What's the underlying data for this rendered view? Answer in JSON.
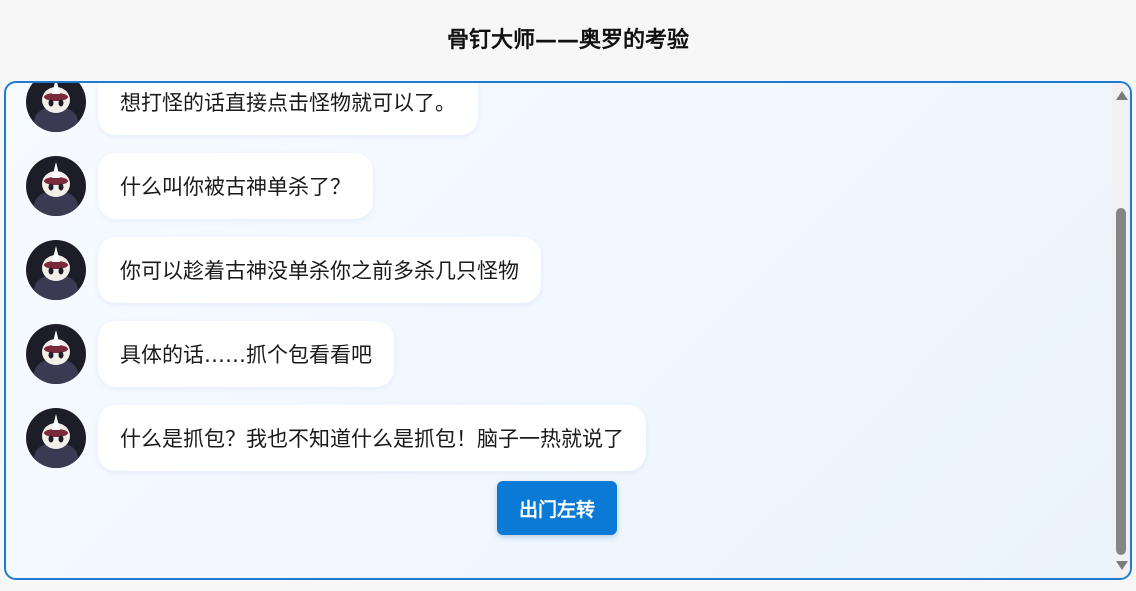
{
  "header": {
    "title": "骨钉大师——奥罗的考验"
  },
  "chat": {
    "messages": [
      {
        "text": "想打怪的话直接点击怪物就可以了。",
        "avatar": "horned-knight-avatar"
      },
      {
        "text": "什么叫你被古神单杀了？",
        "avatar": "horned-knight-avatar"
      },
      {
        "text": "你可以趁着古神没单杀你之前多杀几只怪物",
        "avatar": "horned-knight-avatar"
      },
      {
        "text": "具体的话……抓个包看看吧",
        "avatar": "horned-knight-avatar"
      },
      {
        "text": "什么是抓包？我也不知道什么是抓包！脑子一热就说了",
        "avatar": "horned-knight-avatar"
      }
    ],
    "action_button": "出门左转"
  },
  "colors": {
    "accent": "#1e7bd3",
    "button": "#0a7ad6",
    "avatar_bg": "#1d1d28"
  }
}
